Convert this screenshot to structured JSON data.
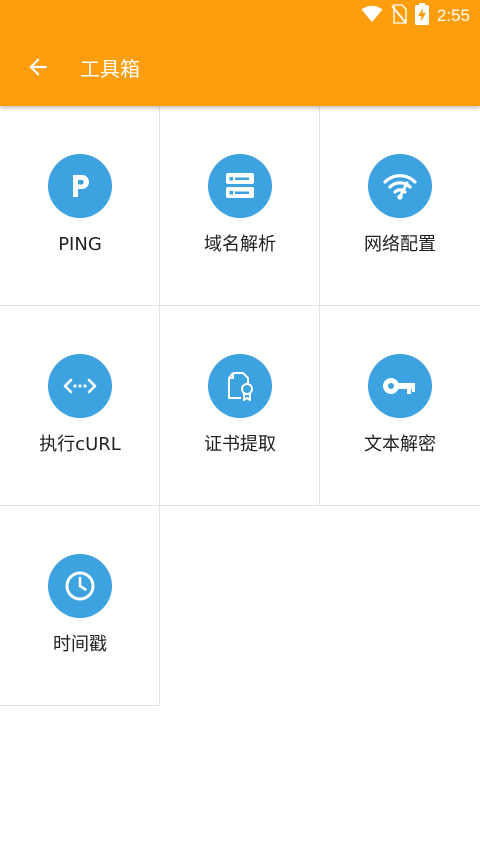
{
  "status_bar": {
    "time": "2:55",
    "icons": [
      "wifi-icon",
      "no-sim-icon",
      "battery-charging-icon"
    ]
  },
  "toolbar": {
    "title": "工具箱",
    "back_icon": "arrow-left-icon"
  },
  "colors": {
    "app_bar": "#ff9e0d",
    "icon_circle": "#3da3e0",
    "divider": "#e2e2e2"
  },
  "tools": [
    {
      "label": "PING",
      "icon": "ping-p-icon"
    },
    {
      "label": "域名解析",
      "icon": "server-icon"
    },
    {
      "label": "网络配置",
      "icon": "wifi-signal-icon"
    },
    {
      "label": "执行cURL",
      "icon": "code-arrows-icon"
    },
    {
      "label": "证书提取",
      "icon": "certificate-icon"
    },
    {
      "label": "文本解密",
      "icon": "key-icon"
    },
    {
      "label": "时间戳",
      "icon": "clock-icon"
    }
  ]
}
